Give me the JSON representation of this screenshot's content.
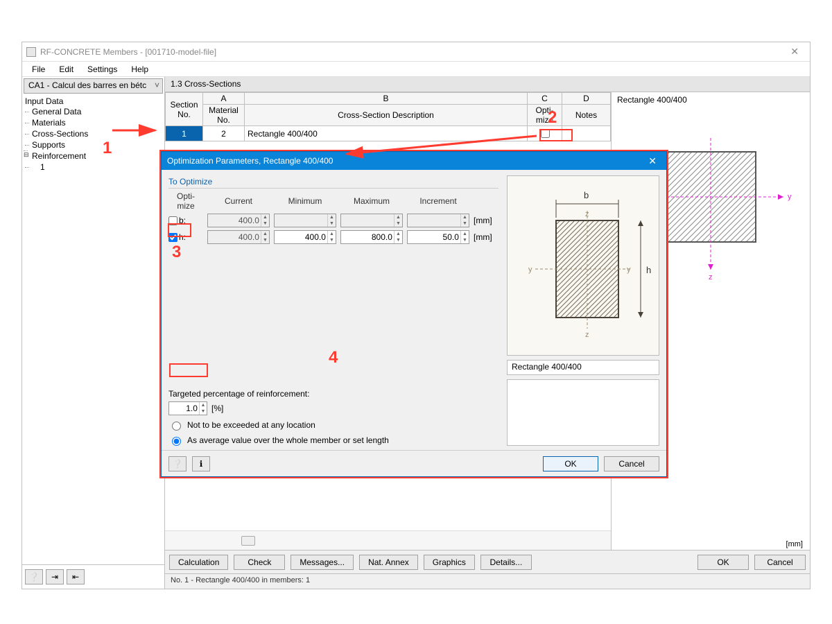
{
  "titlebar": {
    "title": "RF-CONCRETE Members - [001710-model-file]"
  },
  "menu": {
    "file": "File",
    "edit": "Edit",
    "settings": "Settings",
    "help": "Help"
  },
  "sidebar": {
    "combo": "CA1 - Calcul des barres en bétc",
    "root": "Input Data",
    "items": [
      "General Data",
      "Materials",
      "Cross-Sections",
      "Supports"
    ],
    "reinforcement": "Reinforcement",
    "reinf_sub": "1"
  },
  "main": {
    "header": "1.3 Cross-Sections",
    "cols": {
      "A": "A",
      "B": "B",
      "C": "C",
      "D": "D",
      "section_no": "Section\nNo.",
      "material_no": "Material\nNo.",
      "desc": "Cross-Section Description",
      "optimize": "Opti-\nmize",
      "notes": "Notes"
    },
    "row": {
      "section_no": "1",
      "material_no": "2",
      "desc": "Rectangle 400/400"
    }
  },
  "preview": {
    "title": "Rectangle 400/400",
    "unit": "[mm]"
  },
  "buttons": {
    "calculation": "Calculation",
    "check": "Check",
    "messages": "Messages...",
    "nat_annex": "Nat. Annex",
    "graphics": "Graphics",
    "details": "Details...",
    "ok": "OK",
    "cancel": "Cancel"
  },
  "status": "No. 1  -  Rectangle 400/400 in members: 1",
  "dialog": {
    "title": "Optimization Parameters, Rectangle 400/400",
    "group": "To Optimize",
    "hdr_optimize": "Opti-\nmize",
    "hdr_current": "Current",
    "hdr_minimum": "Minimum",
    "hdr_maximum": "Maximum",
    "hdr_increment": "Increment",
    "unit": "[mm]",
    "row_b": {
      "label": "b:",
      "checked": false,
      "current": "400.0"
    },
    "row_h": {
      "label": "h:",
      "checked": true,
      "current": "400.0",
      "min": "400.0",
      "max": "800.0",
      "inc": "50.0"
    },
    "reinf_label": "Targeted percentage of reinforcement:",
    "reinf_value": "1.0",
    "reinf_unit": "[%]",
    "radio1": "Not to be exceeded at any location",
    "radio2": "As average value over the whole member or set length",
    "section_name": "Rectangle 400/400",
    "ok": "OK",
    "cancel": "Cancel"
  },
  "annotations": {
    "n1": "1",
    "n2": "2",
    "n3": "3",
    "n4": "4"
  },
  "axis": {
    "y": "y",
    "z": "z",
    "b": "b",
    "h": "h"
  }
}
